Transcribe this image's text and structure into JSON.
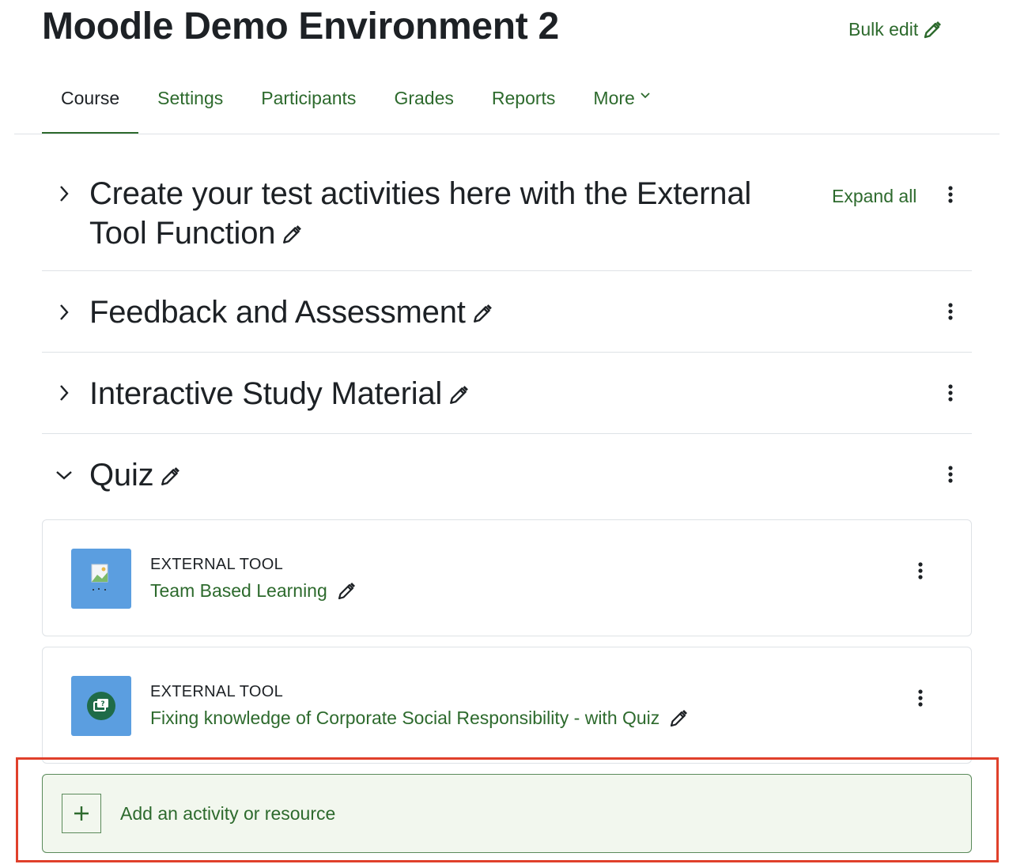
{
  "header": {
    "course_title": "Moodle Demo Environment 2",
    "bulk_edit_label": "Bulk edit"
  },
  "tabs": [
    {
      "label": "Course",
      "active": true
    },
    {
      "label": "Settings"
    },
    {
      "label": "Participants"
    },
    {
      "label": "Grades"
    },
    {
      "label": "Reports"
    },
    {
      "label": "More"
    }
  ],
  "course": {
    "expand_all_label": "Expand all",
    "sections": [
      {
        "title_line1": "Create your test activities here with the External",
        "title_line2": "Tool Function",
        "expanded": false
      },
      {
        "title": "Feedback and Assessment",
        "expanded": false
      },
      {
        "title": "Interactive Study Material",
        "expanded": false
      },
      {
        "title": "Quiz",
        "expanded": true
      }
    ],
    "activities": [
      {
        "type": "EXTERNAL TOOL",
        "name": "Team Based Learning",
        "icon": "broken-image-icon"
      },
      {
        "type": "EXTERNAL TOOL",
        "name": "Fixing knowledge of Corporate Social Responsibility - with Quiz",
        "icon": "quiz-cards-icon"
      }
    ],
    "add_activity_label": "Add an activity or resource"
  },
  "colors": {
    "link_green": "#2d6a2d",
    "text_dark": "#1d2125",
    "activity_icon_bg": "#5b9ee0",
    "add_bg": "#f2f7ee",
    "highlight_red": "#e0402b"
  }
}
